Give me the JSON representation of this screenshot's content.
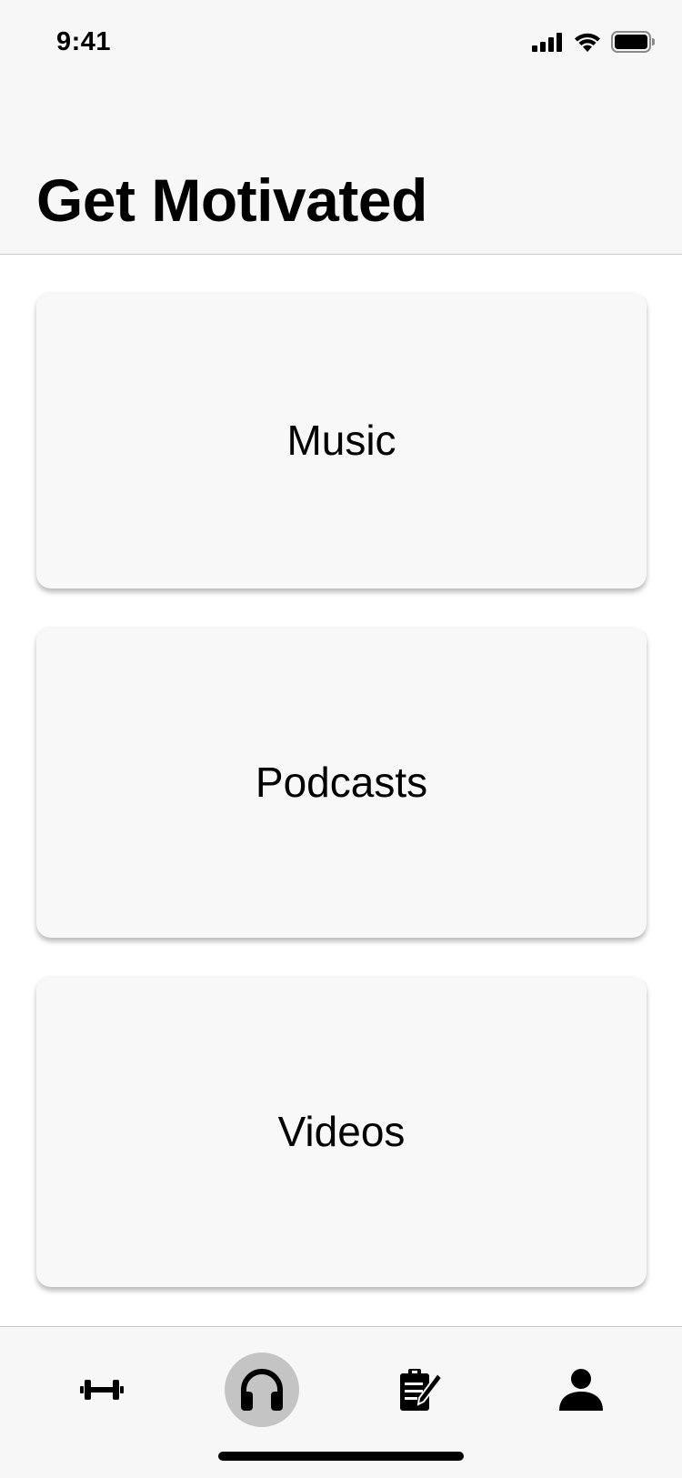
{
  "status_bar": {
    "time": "9:41",
    "icons": [
      "cellular-signal-icon",
      "wifi-icon",
      "battery-icon"
    ]
  },
  "header": {
    "title": "Get Motivated"
  },
  "cards": [
    {
      "label": "Music"
    },
    {
      "label": "Podcasts"
    },
    {
      "label": "Videos"
    }
  ],
  "tab_bar": {
    "items": [
      {
        "icon": "dumbbell-icon",
        "active": false
      },
      {
        "icon": "headphones-icon",
        "active": true
      },
      {
        "icon": "clipboard-pencil-icon",
        "active": false
      },
      {
        "icon": "person-icon",
        "active": false
      }
    ],
    "active_color": "#c4c4c4"
  },
  "colors": {
    "header_background": "#f7f7f7",
    "card_background": "#f8f8f8",
    "page_background": "#ffffff"
  }
}
